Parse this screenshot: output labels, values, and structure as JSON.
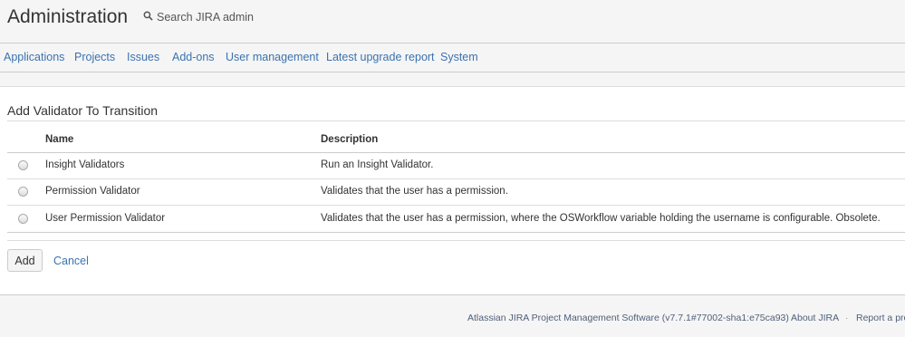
{
  "header": {
    "title": "Administration",
    "search_placeholder": "Search JIRA admin"
  },
  "nav": {
    "items": [
      "Applications",
      "Projects",
      "Issues",
      "Add-ons",
      "User management",
      "Latest upgrade report",
      "System"
    ]
  },
  "main": {
    "section_title": "Add Validator To Transition",
    "columns": {
      "name": "Name",
      "description": "Description"
    },
    "rows": [
      {
        "name": "Insight Validators",
        "description": "Run an Insight Validator.",
        "selected": false
      },
      {
        "name": "Permission Validator",
        "description": "Validates that the user has a permission.",
        "selected": false
      },
      {
        "name": "User Permission Validator",
        "description": "Validates that the user has a permission, where the OSWorkflow variable holding the username is configurable. Obsolete.",
        "selected": false
      }
    ],
    "add_label": "Add",
    "cancel_label": "Cancel"
  },
  "footer": {
    "version_text": "Atlassian JIRA Project Management Software (v7.7.1#77002-sha1:e75ca93)",
    "about_label": "About JIRA",
    "report_label": "Report a pro"
  },
  "colors": {
    "link": "#3b73af",
    "text": "#333333",
    "header_bg": "#f5f5f5",
    "border": "#cccccc"
  }
}
